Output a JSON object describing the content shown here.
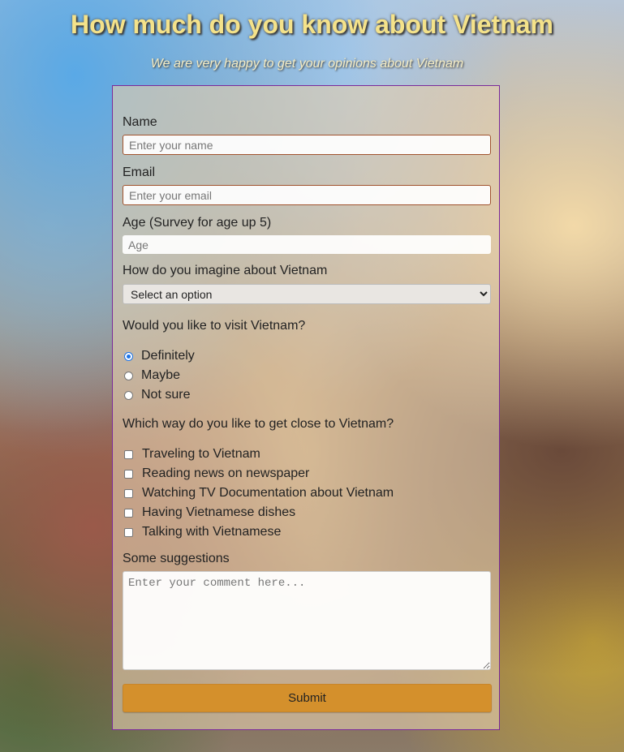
{
  "page": {
    "title": "How much do you know about Vietnam",
    "subtitle": "We are very happy to get your opinions about Vietnam"
  },
  "form": {
    "name": {
      "label": "Name",
      "placeholder": "Enter your name",
      "value": ""
    },
    "email": {
      "label": "Email",
      "placeholder": "Enter your email",
      "value": ""
    },
    "age": {
      "label": "Age (Survey for age up 5)",
      "placeholder": "Age",
      "value": ""
    },
    "imagine": {
      "label": "How do you imagine about Vietnam",
      "selected": "Select an option"
    },
    "visit": {
      "question": "Would you like to visit Vietnam?",
      "options": [
        {
          "label": "Definitely",
          "checked": true
        },
        {
          "label": "Maybe",
          "checked": false
        },
        {
          "label": "Not sure",
          "checked": false
        }
      ]
    },
    "ways": {
      "question": "Which way do you like to get close to Vietnam?",
      "options": [
        {
          "label": "Traveling to Vietnam",
          "checked": false
        },
        {
          "label": "Reading news on newspaper",
          "checked": false
        },
        {
          "label": "Watching TV Documentation about Vietnam",
          "checked": false
        },
        {
          "label": "Having Vietnamese dishes",
          "checked": false
        },
        {
          "label": "Talking with Vietnamese",
          "checked": false
        }
      ]
    },
    "suggestions": {
      "label": "Some suggestions",
      "placeholder": "Enter your comment here...",
      "value": ""
    },
    "submit_label": "Submit"
  },
  "colors": {
    "title": "#f4e28a",
    "form_border": "#7a2a9a",
    "submit_button": "#d4902c",
    "radio_accent": "#1a73e8",
    "input_border": "#a0522d"
  }
}
